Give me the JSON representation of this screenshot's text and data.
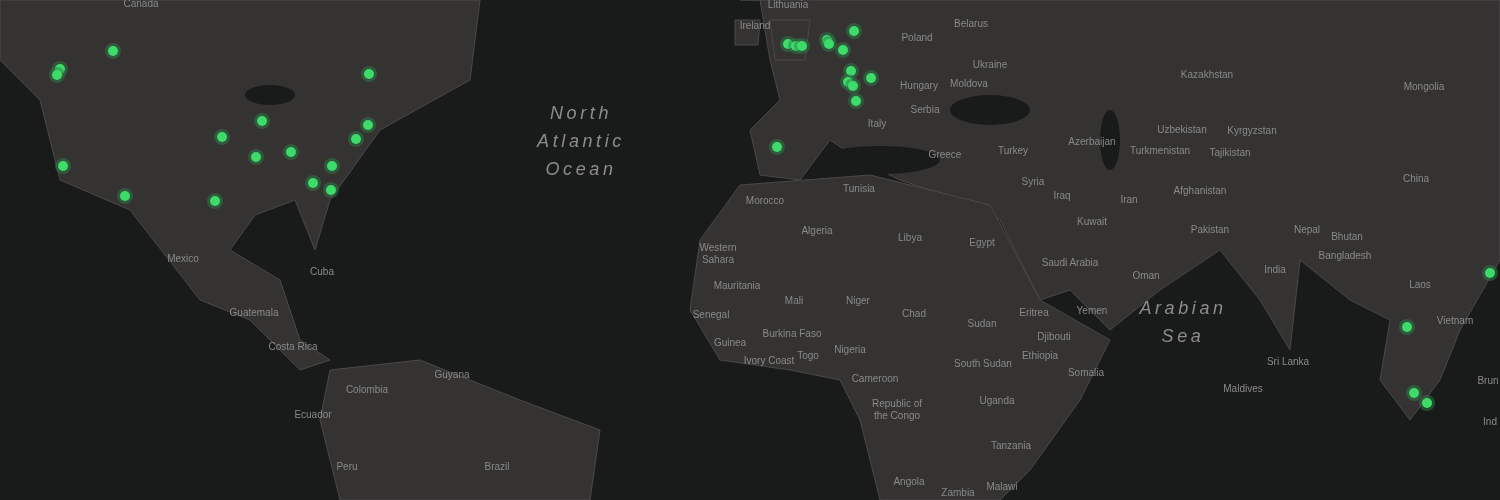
{
  "map": {
    "labels": [
      {
        "text": "Canada",
        "kind": "country"
      },
      {
        "text": "Mexico",
        "kind": "country"
      },
      {
        "text": "Cuba",
        "kind": "country"
      },
      {
        "text": "Guatemala",
        "kind": "country"
      },
      {
        "text": "Costa Rica",
        "kind": "country"
      },
      {
        "text": "Colombia",
        "kind": "country"
      },
      {
        "text": "Guyana",
        "kind": "country"
      },
      {
        "text": "Ecuador",
        "kind": "country"
      },
      {
        "text": "Peru",
        "kind": "country"
      },
      {
        "text": "Brazil",
        "kind": "country"
      },
      {
        "text": "North Atlantic Ocean",
        "kind": "ocean"
      },
      {
        "text": "Ireland",
        "kind": "country"
      },
      {
        "text": "Lithuania",
        "kind": "country"
      },
      {
        "text": "Belarus",
        "kind": "country"
      },
      {
        "text": "Poland",
        "kind": "country"
      },
      {
        "text": "Ukraine",
        "kind": "country"
      },
      {
        "text": "Hungary",
        "kind": "country"
      },
      {
        "text": "Moldova",
        "kind": "country"
      },
      {
        "text": "Serbia",
        "kind": "country"
      },
      {
        "text": "Italy",
        "kind": "country"
      },
      {
        "text": "Greece",
        "kind": "country"
      },
      {
        "text": "Turkey",
        "kind": "country"
      },
      {
        "text": "Azerbaijan",
        "kind": "country"
      },
      {
        "text": "Syria",
        "kind": "country"
      },
      {
        "text": "Iraq",
        "kind": "country"
      },
      {
        "text": "Kuwait",
        "kind": "country"
      },
      {
        "text": "Tunisia",
        "kind": "country"
      },
      {
        "text": "Morocco",
        "kind": "country"
      },
      {
        "text": "Algeria",
        "kind": "country"
      },
      {
        "text": "Libya",
        "kind": "country"
      },
      {
        "text": "Egypt",
        "kind": "country"
      },
      {
        "text": "Western Sahara",
        "kind": "country"
      },
      {
        "text": "Saudi Arabia",
        "kind": "country"
      },
      {
        "text": "Mauritania",
        "kind": "country"
      },
      {
        "text": "Mali",
        "kind": "country"
      },
      {
        "text": "Niger",
        "kind": "country"
      },
      {
        "text": "Chad",
        "kind": "country"
      },
      {
        "text": "Sudan",
        "kind": "country"
      },
      {
        "text": "Senegal",
        "kind": "country"
      },
      {
        "text": "Eritrea",
        "kind": "country"
      },
      {
        "text": "Yemen",
        "kind": "country"
      },
      {
        "text": "Burkina Faso",
        "kind": "country"
      },
      {
        "text": "Djibouti",
        "kind": "country"
      },
      {
        "text": "Guinea",
        "kind": "country"
      },
      {
        "text": "Togo",
        "kind": "country"
      },
      {
        "text": "Ivory Coast",
        "kind": "country"
      },
      {
        "text": "Nigeria",
        "kind": "country"
      },
      {
        "text": "Ethiopia",
        "kind": "country"
      },
      {
        "text": "South Sudan",
        "kind": "country"
      },
      {
        "text": "Somalia",
        "kind": "country"
      },
      {
        "text": "Cameroon",
        "kind": "country"
      },
      {
        "text": "Republic of the Congo",
        "kind": "country"
      },
      {
        "text": "Uganda",
        "kind": "country"
      },
      {
        "text": "Tanzania",
        "kind": "country"
      },
      {
        "text": "Angola",
        "kind": "country"
      },
      {
        "text": "Zambia",
        "kind": "country"
      },
      {
        "text": "Malawi",
        "kind": "country"
      },
      {
        "text": "Kazakhstan",
        "kind": "country"
      },
      {
        "text": "Mongolia",
        "kind": "country"
      },
      {
        "text": "Uzbekistan",
        "kind": "country"
      },
      {
        "text": "Kyrgyzstan",
        "kind": "country"
      },
      {
        "text": "Turkmenistan",
        "kind": "country"
      },
      {
        "text": "Tajikistan",
        "kind": "country"
      },
      {
        "text": "China",
        "kind": "country"
      },
      {
        "text": "Afghanistan",
        "kind": "country"
      },
      {
        "text": "Iran",
        "kind": "country"
      },
      {
        "text": "Pakistan",
        "kind": "country"
      },
      {
        "text": "Nepal",
        "kind": "country"
      },
      {
        "text": "Bhutan",
        "kind": "country"
      },
      {
        "text": "Bangladesh",
        "kind": "country"
      },
      {
        "text": "India",
        "kind": "country"
      },
      {
        "text": "Oman",
        "kind": "country"
      },
      {
        "text": "Laos",
        "kind": "country"
      },
      {
        "text": "Arabian Sea",
        "kind": "ocean"
      },
      {
        "text": "Vietnam",
        "kind": "country"
      },
      {
        "text": "Sri Lanka",
        "kind": "country"
      },
      {
        "text": "Maldives",
        "kind": "country"
      },
      {
        "text": "Brun",
        "kind": "country"
      },
      {
        "text": "Ind",
        "kind": "country"
      }
    ]
  }
}
